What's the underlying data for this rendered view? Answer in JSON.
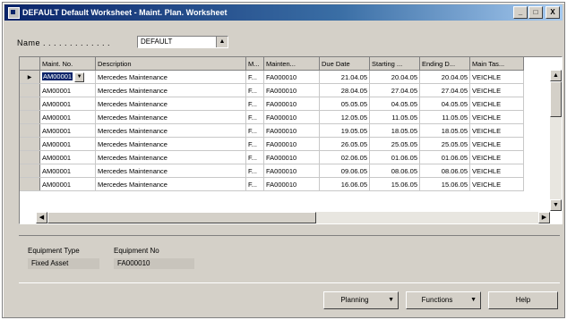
{
  "window": {
    "title": "DEFAULT Default Worksheet - Maint. Plan. Worksheet",
    "minimize": "_",
    "maximize": "□",
    "close": "X"
  },
  "name_field": {
    "label": "Name . . . . . . . . . . . . .",
    "value": "DEFAULT",
    "dropdown_glyph": "▲"
  },
  "grid": {
    "columns": [
      "Maint. No.",
      "Description",
      "M...",
      "Mainten...",
      "Due Date",
      "Starting ...",
      "Ending D...",
      "Main Tas..."
    ],
    "current_row_marker": "▶",
    "cell_dropdown_glyph": "▼",
    "rows": [
      [
        "AM00001",
        "Mercedes Maintenance",
        "F...",
        "FA000010",
        "21.04.05",
        "20.04.05",
        "20.04.05",
        "VEICHLE"
      ],
      [
        "AM00001",
        "Mercedes Maintenance",
        "F...",
        "FA000010",
        "28.04.05",
        "27.04.05",
        "27.04.05",
        "VEICHLE"
      ],
      [
        "AM00001",
        "Mercedes Maintenance",
        "F...",
        "FA000010",
        "05.05.05",
        "04.05.05",
        "04.05.05",
        "VEICHLE"
      ],
      [
        "AM00001",
        "Mercedes Maintenance",
        "F...",
        "FA000010",
        "12.05.05",
        "11.05.05",
        "11.05.05",
        "VEICHLE"
      ],
      [
        "AM00001",
        "Mercedes Maintenance",
        "F...",
        "FA000010",
        "19.05.05",
        "18.05.05",
        "18.05.05",
        "VEICHLE"
      ],
      [
        "AM00001",
        "Mercedes Maintenance",
        "F...",
        "FA000010",
        "26.05.05",
        "25.05.05",
        "25.05.05",
        "VEICHLE"
      ],
      [
        "AM00001",
        "Mercedes Maintenance",
        "F...",
        "FA000010",
        "02.06.05",
        "01.06.05",
        "01.06.05",
        "VEICHLE"
      ],
      [
        "AM00001",
        "Mercedes Maintenance",
        "F...",
        "FA000010",
        "09.06.05",
        "08.06.05",
        "08.06.05",
        "VEICHLE"
      ],
      [
        "AM00001",
        "Mercedes Maintenance",
        "F...",
        "FA000010",
        "16.06.05",
        "15.06.05",
        "15.06.05",
        "VEICHLE"
      ]
    ]
  },
  "scroll": {
    "up": "▲",
    "down": "▼",
    "left": "◀",
    "right": "▶"
  },
  "info": {
    "equipment_type_label": "Equipment Type",
    "equipment_type_value": "Fixed Asset",
    "equipment_no_label": "Equipment No",
    "equipment_no_value": "FA000010"
  },
  "buttons": {
    "planning": "Planning",
    "functions": "Functions",
    "help": "Help",
    "menu_arrow": "▼"
  }
}
